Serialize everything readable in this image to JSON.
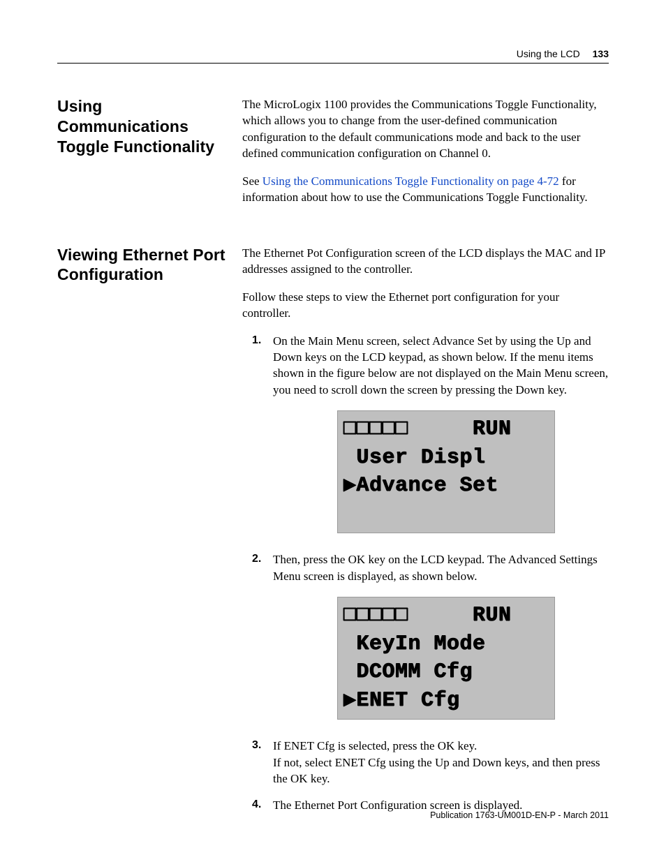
{
  "header": {
    "section": "Using the LCD",
    "page_number": "133"
  },
  "sec1": {
    "heading": "Using Communications Toggle Functionality",
    "p1": "The MicroLogix 1100 provides the Communications Toggle Functionality, which allows you to change from the user-defined communication configuration to the default communications mode and back to the user defined communication configuration on Channel 0.",
    "p2_link_prefix": "See  ",
    "p2_link_text": "Using the Communications Toggle Functionality on page 4-72",
    "p2_after_link": " for information about how to use the Communications Toggle Functionality."
  },
  "sec2": {
    "heading": "Viewing Ethernet Port Configuration",
    "p1": "The Ethernet Pot Configuration screen of the LCD displays the MAC and IP addresses assigned to the controller.",
    "p2": "Follow these steps to view the Ethernet port configuration for your controller.",
    "steps": [
      {
        "n": "1",
        "text": "On the Main Menu screen, select Advance Set by using the Up and Down keys on the LCD keypad, as shown below. If the menu items shown in the figure below are not displayed on the Main Menu screen, you need to scroll down the screen by pressing the Down key."
      },
      {
        "n": "2",
        "text": "Then, press the OK key on the LCD keypad. The Advanced Settings Menu screen is displayed, as shown below."
      },
      {
        "n": "3",
        "text_a": "If ENET Cfg is selected, press the OK key.",
        "text_b": "If not, select ENET Cfg using the Up and Down keys, and then press the OK key."
      },
      {
        "n": "4",
        "text": "The Ethernet Port Configuration screen is displayed."
      }
    ],
    "lcd1": {
      "line1": "□□□□□     RUN",
      "line2": " User Displ",
      "line3": "▶Advance Set",
      "line4": " "
    },
    "lcd2": {
      "line1": "□□□□□     RUN",
      "line2": " KeyIn Mode",
      "line3": " DCOMM Cfg",
      "line4": "▶ENET Cfg"
    }
  },
  "footer": {
    "publine": "Publication 1763-UM001D-EN-P - March 2011"
  }
}
